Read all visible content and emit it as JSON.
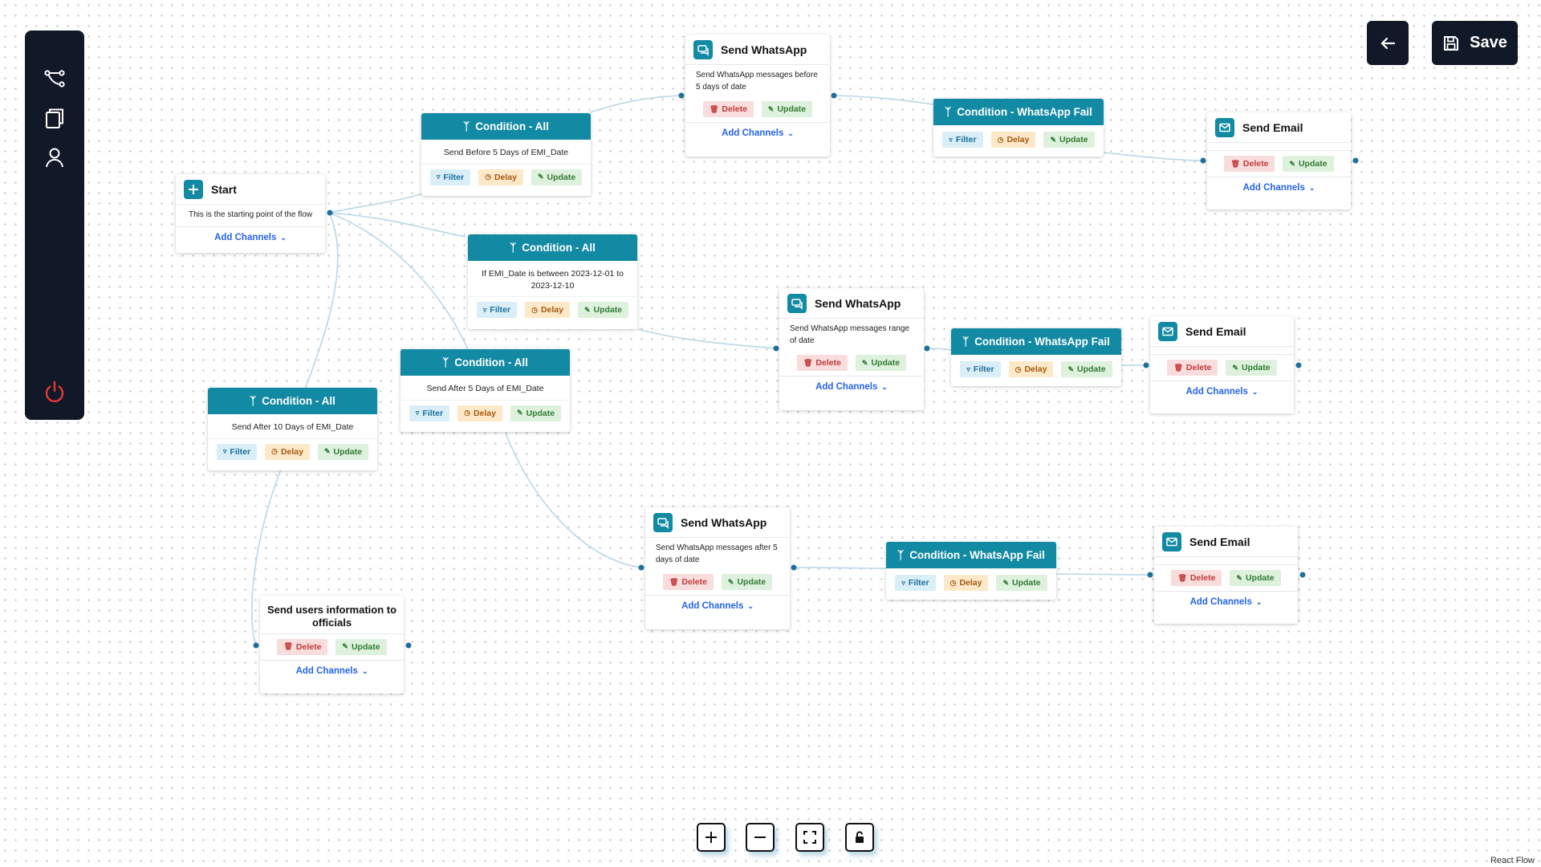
{
  "sidebar": {
    "items": [
      {
        "icon": "flow-icon"
      },
      {
        "icon": "templates-icon"
      },
      {
        "icon": "user-icon"
      }
    ],
    "power_icon": "power-icon"
  },
  "header": {
    "back_icon": "arrow-left-icon",
    "save_label": "Save"
  },
  "labels": {
    "filter": "Filter",
    "delay": "Delay",
    "update": "Update",
    "delete": "Delete",
    "add_channels": "Add Channels"
  },
  "nodes": {
    "start": {
      "title": "Start",
      "desc": "This is the starting point of the flow"
    },
    "cond_before5": {
      "title": "Condition - All",
      "desc": "Send Before 5 Days of EMI_Date"
    },
    "cond_between": {
      "title": "Condition - All",
      "desc": "If EMI_Date is between 2023-12-01 to 2023-12-10"
    },
    "cond_after5": {
      "title": "Condition - All",
      "desc": "Send After 5 Days of EMI_Date"
    },
    "cond_after10": {
      "title": "Condition - All",
      "desc": "Send After 10 Days of EMI_Date"
    },
    "wa_before": {
      "title": "Send WhatsApp",
      "desc": "Send WhatsApp messages before 5 days of date"
    },
    "wa_range": {
      "title": "Send WhatsApp",
      "desc": "Send WhatsApp messages range of date"
    },
    "wa_after": {
      "title": "Send WhatsApp",
      "desc": "Send WhatsApp messages after 5 days of date"
    },
    "fail_1": {
      "title": "Condition - WhatsApp Fail"
    },
    "fail_2": {
      "title": "Condition - WhatsApp Fail"
    },
    "fail_3": {
      "title": "Condition - WhatsApp Fail"
    },
    "email_1": {
      "title": "Send Email"
    },
    "email_2": {
      "title": "Send Email"
    },
    "email_3": {
      "title": "Send Email"
    },
    "officials": {
      "title": "Send users information to officials"
    }
  },
  "controls": {
    "zoom_in": "plus-icon",
    "zoom_out": "minus-icon",
    "fit_view": "fit-view-icon",
    "lock": "lock-icon"
  },
  "attribution": "React Flow",
  "colors": {
    "accent": "#138aa3",
    "dark": "#111827",
    "link": "#2563eb",
    "edge": "#b9d7e6",
    "power": "#e53935"
  }
}
